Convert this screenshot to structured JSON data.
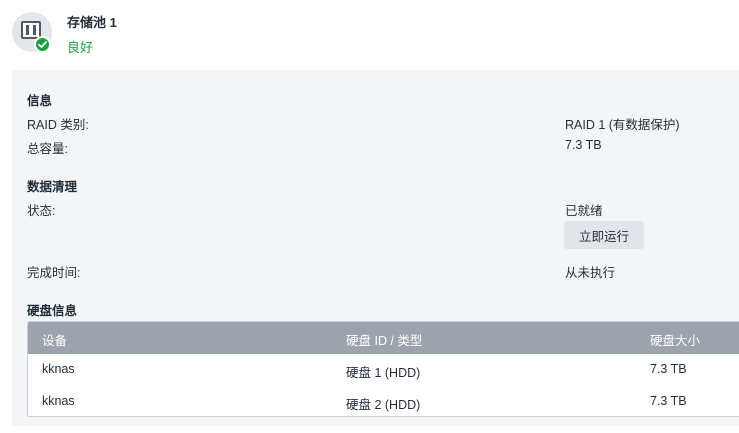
{
  "pool": {
    "title": "存储池 1",
    "status": "良好"
  },
  "info": {
    "title": "信息",
    "raid_label": "RAID 类别:",
    "raid_value": "RAID 1 (有数据保护)",
    "capacity_label": "总容量:",
    "capacity_value": "7.3 TB"
  },
  "scrub": {
    "title": "数据清理",
    "status_label": "状态:",
    "status_value": "已就绪",
    "run_button": "立即运行",
    "completed_label": "完成时间:",
    "completed_value": "从未执行"
  },
  "disks": {
    "title": "硬盘信息",
    "columns": [
      "设备",
      "硬盘 ID / 类型",
      "硬盘大小"
    ],
    "rows": [
      [
        "kknas",
        "硬盘 1 (HDD)",
        "7.3 TB"
      ],
      [
        "kknas",
        "硬盘 2 (HDD)",
        "7.3 TB"
      ]
    ]
  },
  "colors": {
    "healthy": "#1aa142",
    "table_header": "#9ca3ac",
    "panel": "#f4f5f7"
  },
  "icons": {
    "pool": "storage-pool-icon",
    "status": "check-badge-icon"
  }
}
